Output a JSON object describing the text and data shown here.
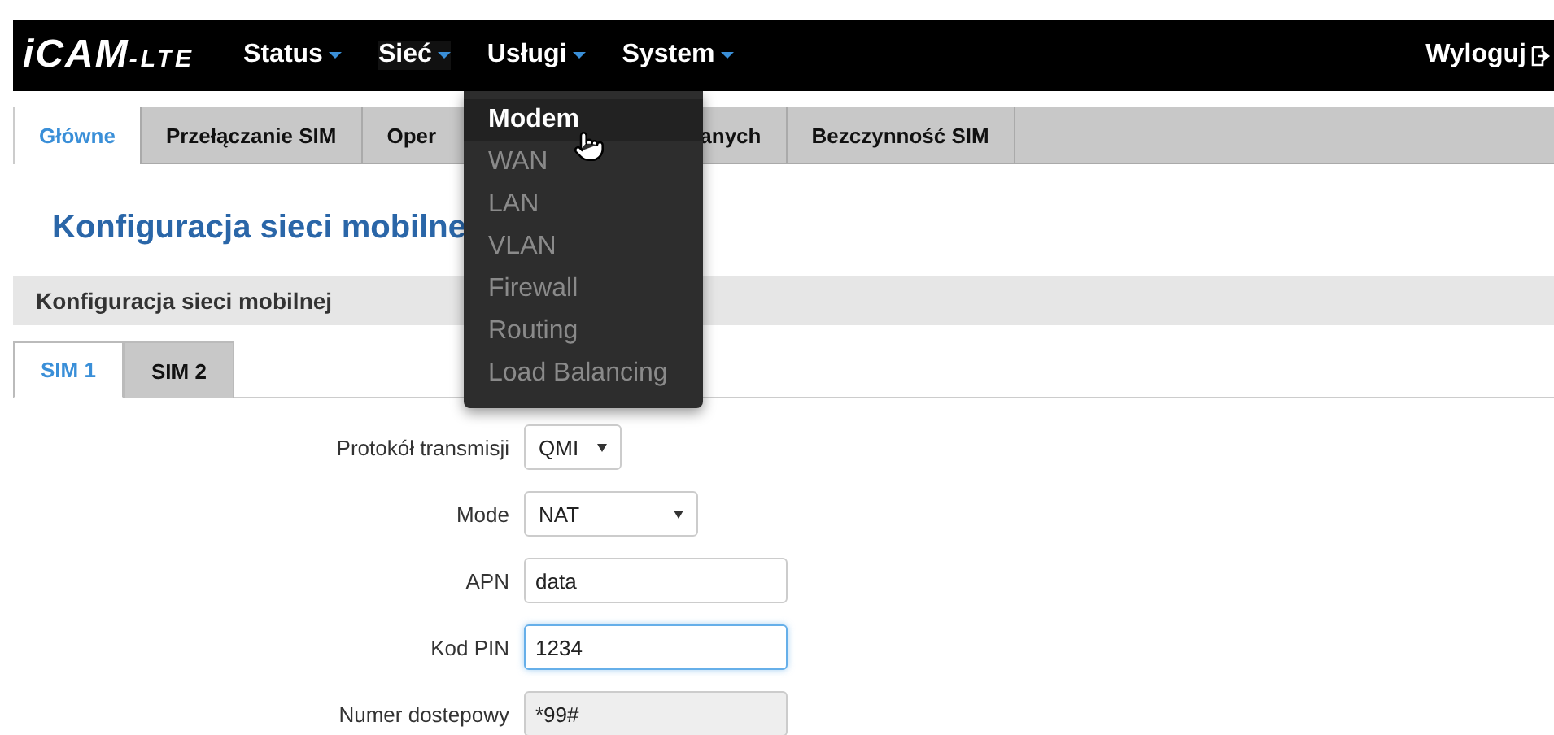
{
  "logo": {
    "main": "iCAM",
    "suffix": "-LTE"
  },
  "nav": [
    {
      "label": "Status",
      "open": false
    },
    {
      "label": "Sieć",
      "open": true
    },
    {
      "label": "Usługi",
      "open": false
    },
    {
      "label": "System",
      "open": false
    }
  ],
  "logout": "Wyloguj",
  "dropdown": [
    {
      "label": "Modem",
      "selected": true
    },
    {
      "label": "WAN",
      "selected": false
    },
    {
      "label": "LAN",
      "selected": false
    },
    {
      "label": "VLAN",
      "selected": false
    },
    {
      "label": "Firewall",
      "selected": false
    },
    {
      "label": "Routing",
      "selected": false
    },
    {
      "label": "Load Balancing",
      "selected": false
    }
  ],
  "tabs": [
    {
      "label": "Główne",
      "selected": true
    },
    {
      "label": "Przełączanie SIM",
      "selected": false
    },
    {
      "label": "Oper",
      "selected": false
    },
    {
      "label": "anych",
      "selected": false
    },
    {
      "label": "Bezczynność SIM",
      "selected": false
    }
  ],
  "heading": "Konfiguracja sieci mobilne",
  "section": "Konfiguracja sieci mobilnej",
  "sim_tabs": [
    {
      "label": "SIM 1",
      "selected": true
    },
    {
      "label": "SIM 2",
      "selected": false
    }
  ],
  "fields": [
    {
      "kind": "select",
      "label": "Protokół transmisji",
      "value": "QMI",
      "narrow": true
    },
    {
      "kind": "select",
      "label": "Mode",
      "value": "NAT",
      "narrow": false
    },
    {
      "kind": "text",
      "label": "APN",
      "value": "data",
      "focused": false,
      "disabled": false
    },
    {
      "kind": "text",
      "label": "Kod PIN",
      "value": "1234",
      "focused": true,
      "disabled": false
    },
    {
      "kind": "text",
      "label": "Numer dostepowy",
      "value": "*99#",
      "focused": false,
      "disabled": true
    }
  ]
}
